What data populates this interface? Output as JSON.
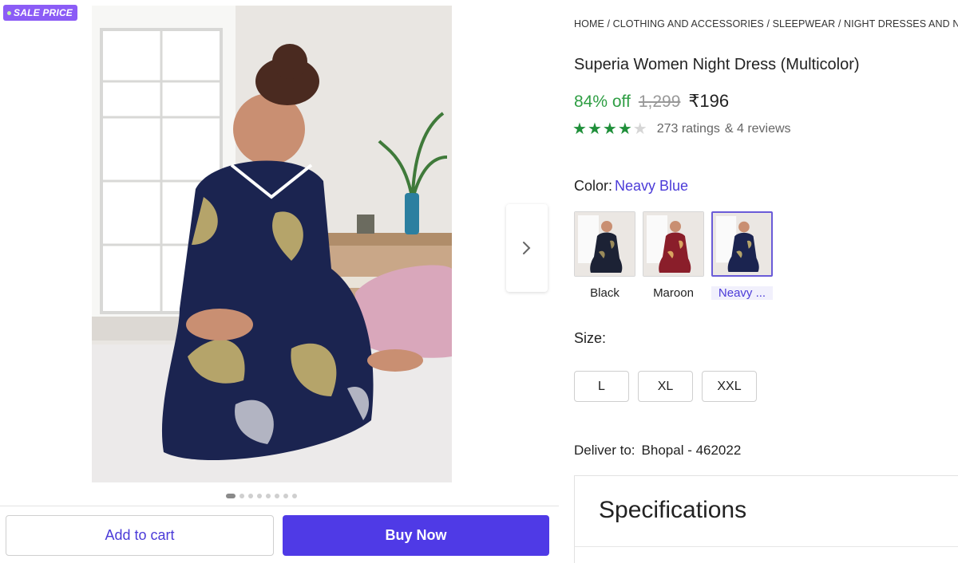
{
  "badge": {
    "label": "SALE PRICE"
  },
  "gallery": {
    "total_images": 8,
    "active_index": 0
  },
  "actions": {
    "add_to_cart": "Add to cart",
    "buy_now": "Buy Now"
  },
  "product": {
    "breadcrumb": "HOME / CLOTHING AND ACCESSORIES / SLEEPWEAR / NIGHT DRESSES AND NIGHTIES",
    "title": "Superia Women Night Dress (Multicolor)",
    "discount": "84% off",
    "mrp": "1,299",
    "price": "₹196",
    "rating": {
      "stars": 4,
      "ratings_text": "273 ratings",
      "reviews_text": "& 4 reviews"
    }
  },
  "color": {
    "label": "Color:",
    "selected": "Neavy Blue",
    "options": [
      {
        "name": "Black",
        "dress": "#1c2235",
        "print": "#9a8a5a"
      },
      {
        "name": "Maroon",
        "dress": "#8a1e2a",
        "print": "#d9a560"
      },
      {
        "name": "Neavy ...",
        "dress": "#1b2450",
        "print": "#b5a46a"
      }
    ]
  },
  "size": {
    "label": "Size:",
    "options": [
      "L",
      "XL",
      "XXL"
    ]
  },
  "delivery": {
    "label": "Deliver to:",
    "location": "Bhopal - 462022"
  },
  "specifications": {
    "title": "Specifications"
  },
  "colors": {
    "accent": "#4f3ae6",
    "discount_green": "#2f9e44",
    "badge_purple": "#8b5cf6"
  },
  "icons": {
    "next": "chevron-right-icon",
    "star": "star-icon"
  }
}
